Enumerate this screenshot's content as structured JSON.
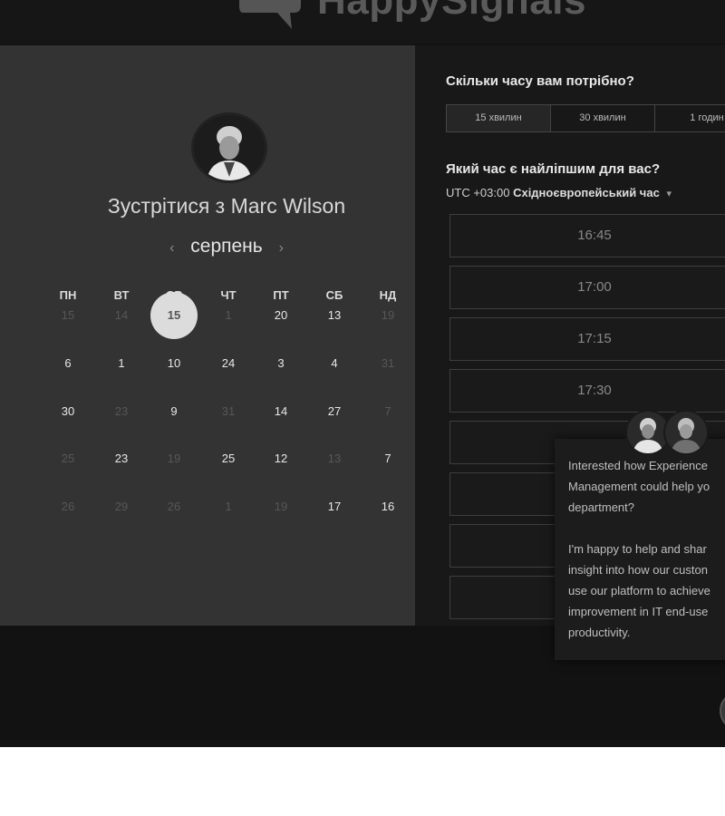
{
  "header": {
    "logo_text": "HappySignals"
  },
  "meeting": {
    "title": "Зустрітися з Marc Wilson"
  },
  "calendar": {
    "month": "серпень",
    "weekdays": [
      "ПН",
      "ВТ",
      "СР",
      "ЧТ",
      "ПТ",
      "СБ",
      "НД"
    ],
    "rows": [
      [
        {
          "t": "15",
          "s": "muted"
        },
        {
          "t": "14",
          "s": "muted"
        },
        {
          "t": "15",
          "s": "selected"
        },
        {
          "t": "1",
          "s": "muted"
        },
        {
          "t": "20",
          "s": "active"
        },
        {
          "t": "13",
          "s": "active"
        },
        {
          "t": "19",
          "s": "muted"
        }
      ],
      [
        {
          "t": "6",
          "s": "active"
        },
        {
          "t": "1",
          "s": "active"
        },
        {
          "t": "10",
          "s": "active"
        },
        {
          "t": "24",
          "s": "active"
        },
        {
          "t": "3",
          "s": "active"
        },
        {
          "t": "4",
          "s": "active"
        },
        {
          "t": "31",
          "s": "muted"
        }
      ],
      [
        {
          "t": "30",
          "s": "active"
        },
        {
          "t": "23",
          "s": "muted"
        },
        {
          "t": "9",
          "s": "active"
        },
        {
          "t": "31",
          "s": "muted"
        },
        {
          "t": "14",
          "s": "active"
        },
        {
          "t": "27",
          "s": "active"
        },
        {
          "t": "7",
          "s": "muted"
        }
      ],
      [
        {
          "t": "25",
          "s": "muted"
        },
        {
          "t": "23",
          "s": "active"
        },
        {
          "t": "19",
          "s": "muted"
        },
        {
          "t": "25",
          "s": "active"
        },
        {
          "t": "12",
          "s": "active"
        },
        {
          "t": "13",
          "s": "muted"
        },
        {
          "t": "7",
          "s": "active"
        }
      ],
      [
        {
          "t": "26",
          "s": "muted"
        },
        {
          "t": "29",
          "s": "muted"
        },
        {
          "t": "26",
          "s": "muted"
        },
        {
          "t": "1",
          "s": "muted"
        },
        {
          "t": "19",
          "s": "muted"
        },
        {
          "t": "17",
          "s": "active"
        },
        {
          "t": "16",
          "s": "active"
        }
      ]
    ]
  },
  "booking": {
    "duration_question": "Скільки часу вам потрібно?",
    "durations": [
      "15 хвилин",
      "30 хвилин",
      "1 годин"
    ],
    "selected_duration": "15 хвилин",
    "time_question": "Який час є найліпшим для вас?",
    "timezone_offset": "UTC +03:00",
    "timezone_name": "Східноєвропейський час",
    "slots": [
      "16:45",
      "17:00",
      "17:15",
      "17:30",
      "",
      "",
      "",
      ""
    ]
  },
  "chat": {
    "lines_1": [
      "Interested how Experience",
      "Management could help yo",
      "department?"
    ],
    "lines_2": [
      "I'm happy to help and shar",
      "insight into how our custon",
      "use our platform to achieve",
      "improvement in IT end-use",
      "productivity."
    ]
  },
  "colors": {
    "panel_left": "#333333",
    "panel_right": "#181818",
    "background": "#121212",
    "selected_day": "#dcdcdc"
  }
}
